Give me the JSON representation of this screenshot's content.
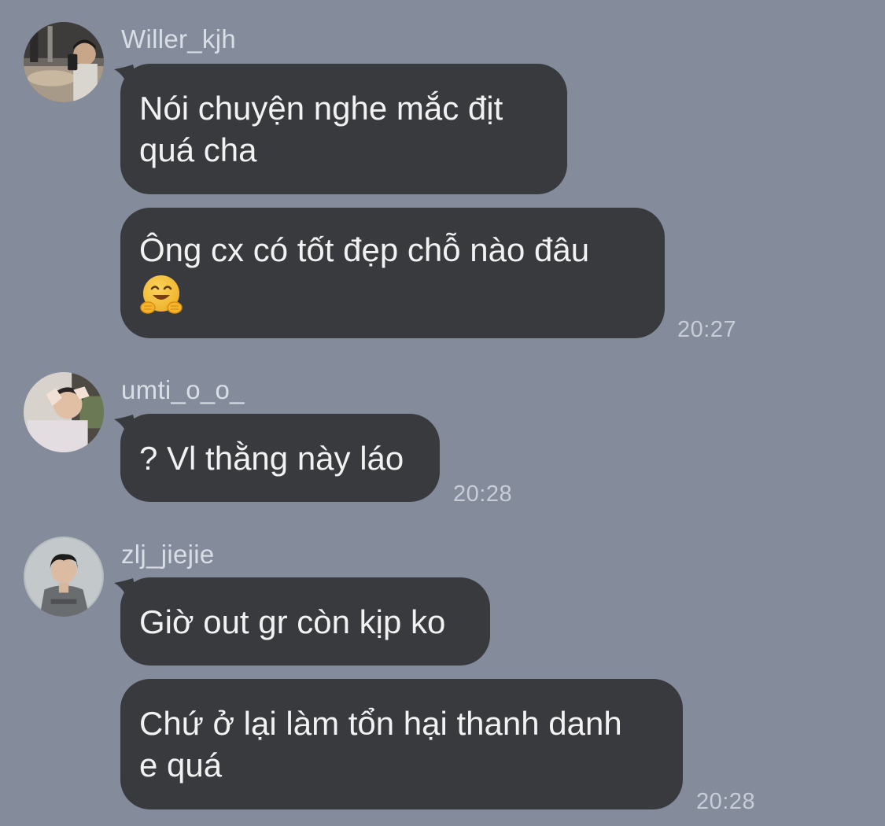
{
  "groups": [
    {
      "sender": "Willer_kjh",
      "avatar_icon": "user-avatar-willer",
      "messages": [
        {
          "lines": [
            "Nói chuyện nghe mắc địt",
            "quá cha"
          ]
        },
        {
          "lines": [
            "Ông cx có tốt đẹp chỗ nào đâu"
          ],
          "emoji": "🤗"
        }
      ],
      "time": "20:27"
    },
    {
      "sender": "umti_o_o_",
      "avatar_icon": "user-avatar-umti",
      "messages": [
        {
          "lines": [
            "? Vl thằng này láo"
          ]
        }
      ],
      "time": "20:28"
    },
    {
      "sender": "zlj_jiejie",
      "avatar_icon": "user-avatar-zlj",
      "messages": [
        {
          "lines": [
            "Giờ out gr còn kịp ko"
          ]
        },
        {
          "lines": [
            "Chứ ở lại làm tổn hại thanh danh",
            "e quá"
          ]
        }
      ],
      "time": "20:28"
    }
  ],
  "colors": {
    "background": "#848b9b",
    "bubble": "#393a3e",
    "bubble_text": "#f2f2f2",
    "sender_text": "#d9dde5",
    "time_text": "#c8ccd6"
  }
}
